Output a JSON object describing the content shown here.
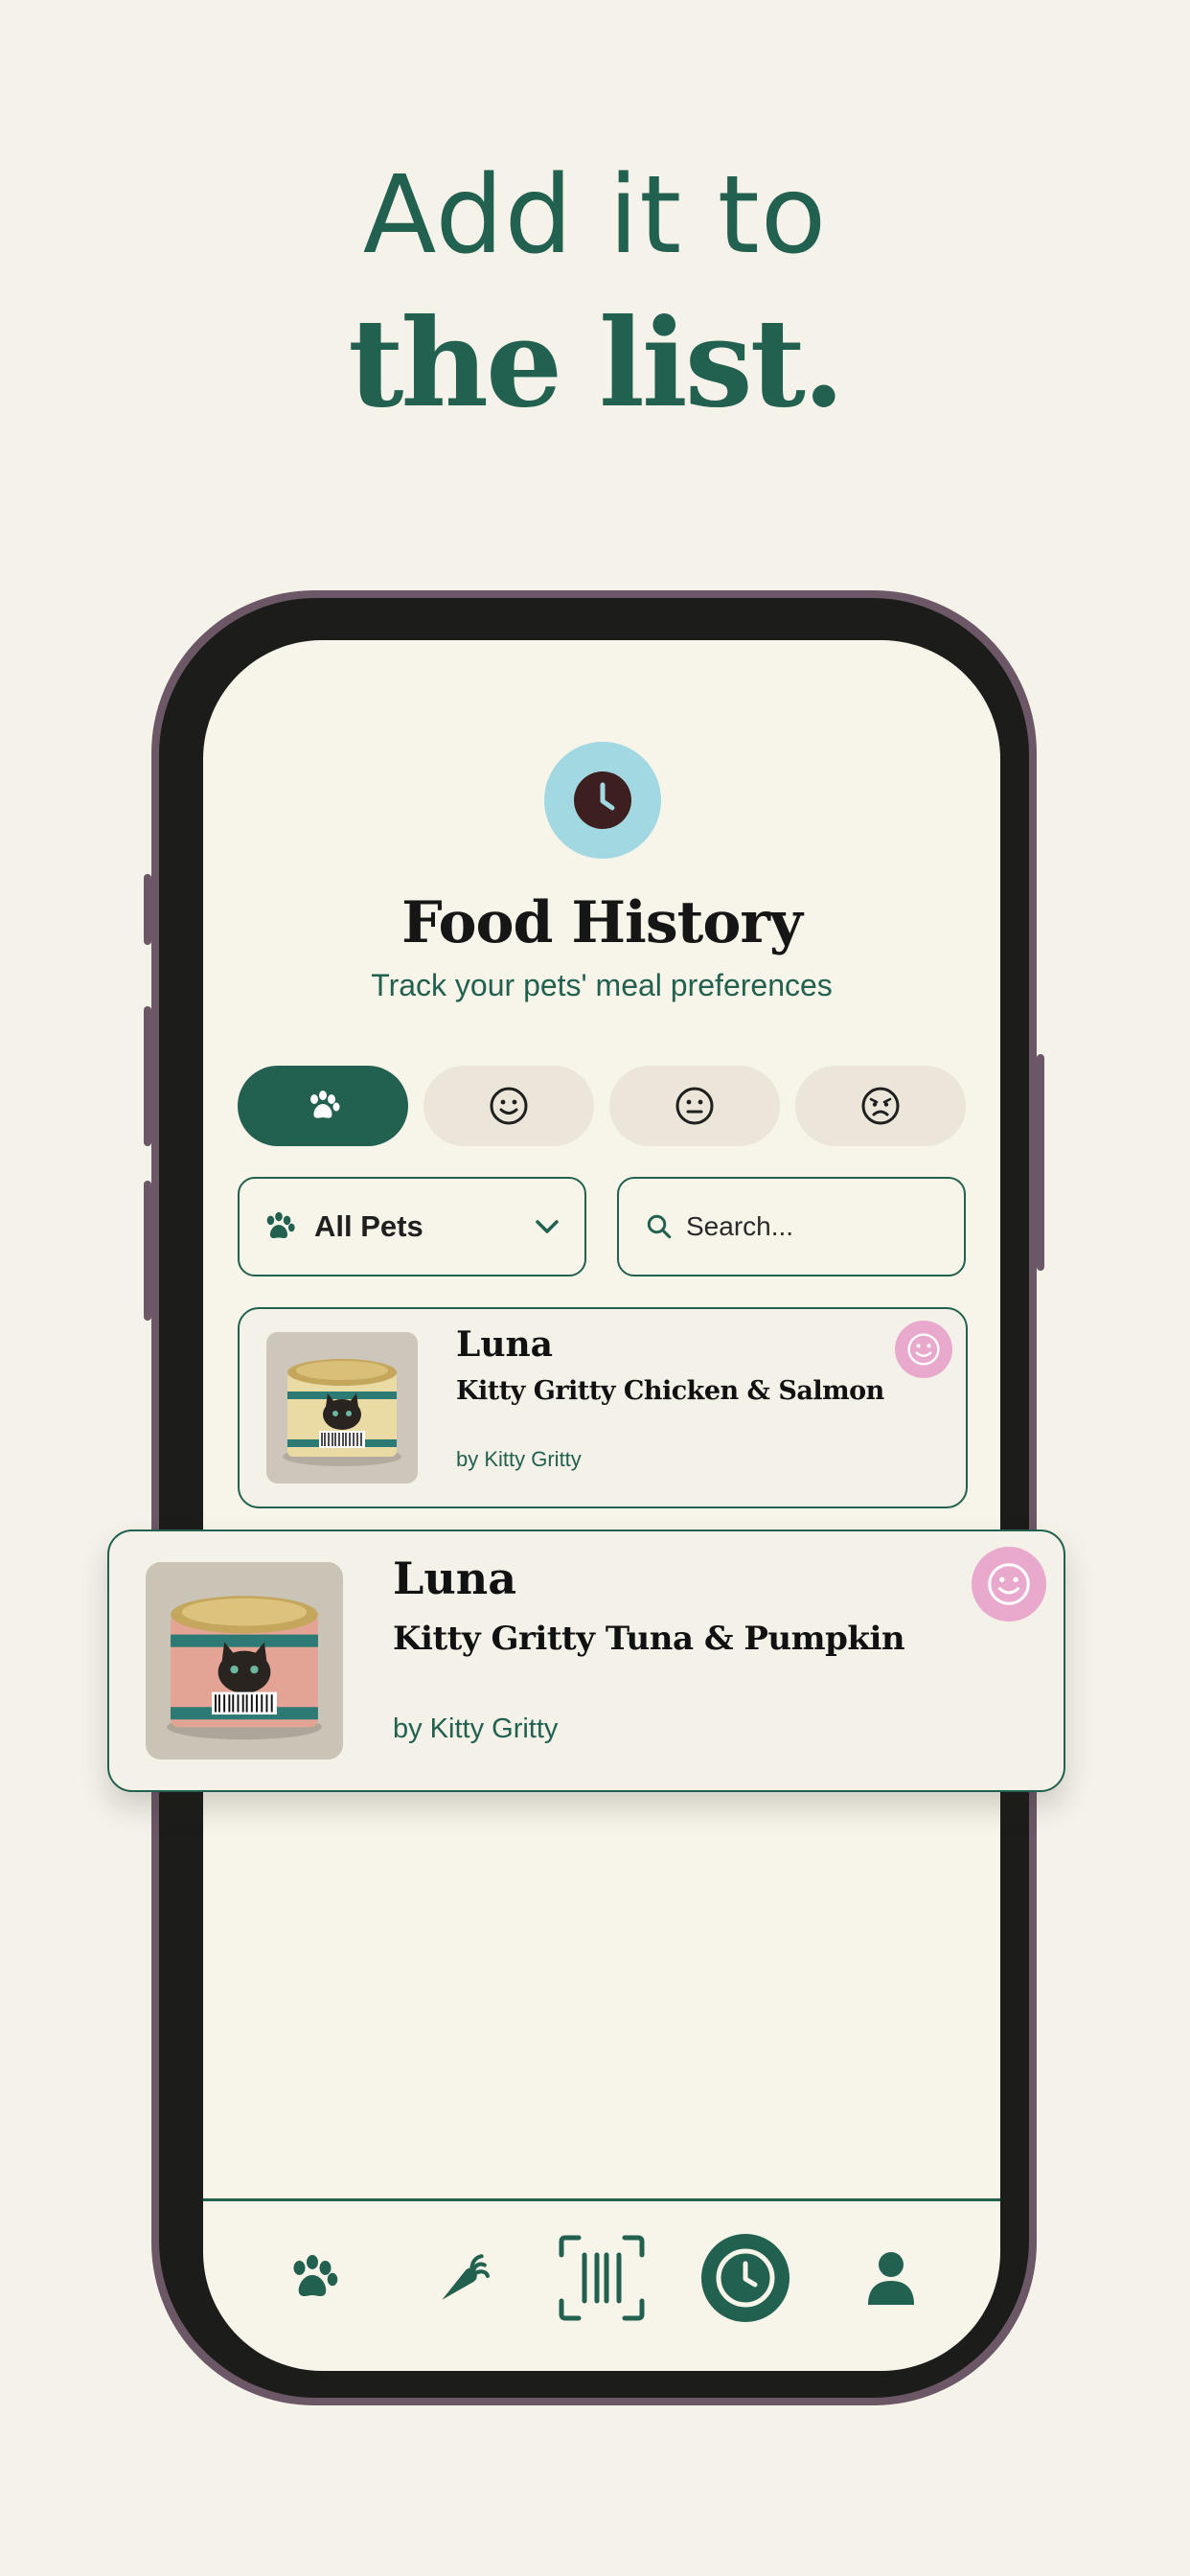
{
  "headline": {
    "line1": "Add it to",
    "line2": "the list."
  },
  "screen": {
    "title": "Food History",
    "subtitle": "Track your pets' meal preferences",
    "filters": [
      {
        "icon": "paw-icon",
        "active": true
      },
      {
        "icon": "smile-icon",
        "active": false
      },
      {
        "icon": "neutral-face-icon",
        "active": false
      },
      {
        "icon": "angry-face-icon",
        "active": false
      }
    ],
    "pet_select": {
      "value": "All Pets"
    },
    "search": {
      "placeholder": "Search..."
    },
    "entries": [
      {
        "pet": "Luna",
        "food": "Kitty Gritty Chicken & Salmon",
        "brand": "by Kitty Gritty",
        "mood": "smile-icon"
      },
      {
        "pet": "Luna",
        "food": "Kitty Gritty Tuna & Pumpkin",
        "brand": "by Kitty Gritty",
        "mood": "smile-icon"
      }
    ],
    "nav": [
      {
        "icon": "paw-icon"
      },
      {
        "icon": "carrot-icon"
      },
      {
        "icon": "barcode-scan-icon"
      },
      {
        "icon": "clock-icon",
        "active": true
      },
      {
        "icon": "profile-icon"
      }
    ]
  },
  "colors": {
    "primary": "#22604f",
    "background": "#f5f2ea",
    "accent_pink": "#e9a9cd",
    "accent_blue": "#a2d8e2"
  }
}
